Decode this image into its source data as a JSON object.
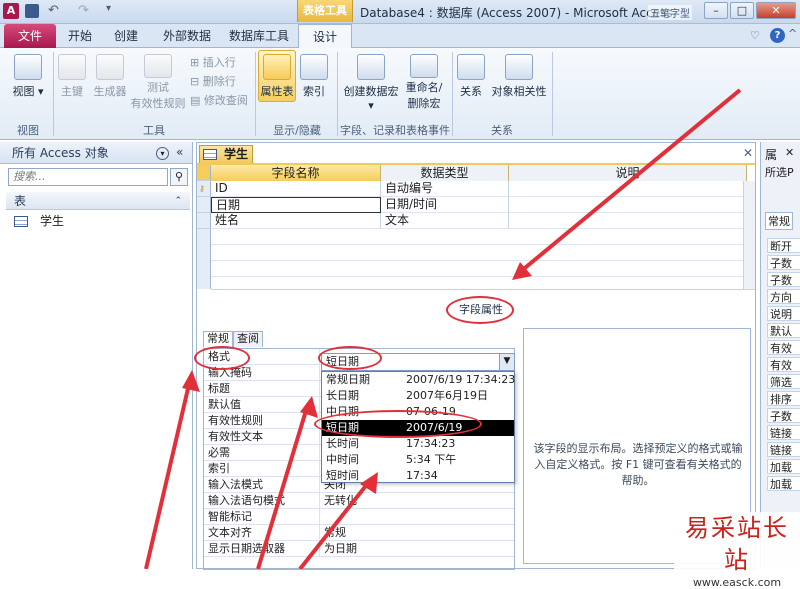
{
  "titlebar": {
    "context_tab": "表格工具",
    "title": "Database4 : 数据库 (Access 2007)  -  Microsoft Access",
    "wm_corner": "五笔字型"
  },
  "tabs": [
    "文件",
    "开始",
    "创建",
    "外部数据",
    "数据库工具",
    "设计"
  ],
  "ribbon": {
    "view": {
      "label": "视图",
      "group": "视图"
    },
    "primary_key": "主键",
    "builder": "生成器",
    "test_rules_l1": "测试",
    "test_rules_l2": "有效性规则",
    "insert_row": "插入行",
    "delete_row": "删除行",
    "modify_lookup": "修改查阅",
    "tools_group": "工具",
    "property_sheet": "属性表",
    "indexes": "索引",
    "showhide_group": "显示/隐藏",
    "create_macro": "创建数据宏",
    "rename_macro_l1": "重命名/",
    "rename_macro_l2": "删除宏",
    "events_group": "字段、记录和表格事件",
    "relationships": "关系",
    "object_dependencies": "对象相关性",
    "rel_group": "关系"
  },
  "nav": {
    "header": "所有 Access 对象",
    "search_placeholder": "搜索...",
    "section": "表",
    "item": "学生"
  },
  "table_tab": "学生",
  "grid": {
    "headers": [
      "字段名称",
      "数据类型",
      "说明"
    ],
    "rows": [
      [
        "ID",
        "自动编号",
        ""
      ],
      [
        "日期",
        "日期/时间",
        ""
      ],
      [
        "姓名",
        "文本",
        ""
      ]
    ]
  },
  "field_props_label": "字段属性",
  "prop_tabs": [
    "常规",
    "查阅"
  ],
  "props": [
    [
      "格式",
      ""
    ],
    [
      "输入掩码",
      ""
    ],
    [
      "标题",
      ""
    ],
    [
      "默认值",
      ""
    ],
    [
      "有效性规则",
      ""
    ],
    [
      "有效性文本",
      ""
    ],
    [
      "必需",
      ""
    ],
    [
      "索引",
      ""
    ],
    [
      "输入法模式",
      "关闭"
    ],
    [
      "输入法语句模式",
      "无转化"
    ],
    [
      "智能标记",
      ""
    ],
    [
      "文本对齐",
      "常规"
    ],
    [
      "显示日期选取器",
      "为日期"
    ]
  ],
  "format_value": "短日期",
  "dropdown": [
    [
      "常规日期",
      "2007/6/19 17:34:23"
    ],
    [
      "长日期",
      "2007年6月19日"
    ],
    [
      "中日期",
      "07-06-19"
    ],
    [
      "短日期",
      "2007/6/19"
    ],
    [
      "长时间",
      "17:34:23"
    ],
    [
      "中时间",
      "5:34 下午"
    ],
    [
      "短时间",
      "17:34"
    ]
  ],
  "help_text": "该字段的显示布局。选择预定义的格式或输入自定义格式。按 F1 键可查看有关格式的帮助。",
  "right_pane": {
    "title": "属",
    "subtitle": "所选P",
    "tab": "常规",
    "items": [
      "断开",
      "子数",
      "子数",
      "方向",
      "说明",
      "默认",
      "有效",
      "有效",
      "筛选",
      "排序",
      "子数",
      "链接",
      "链接",
      "加载",
      "加载"
    ]
  },
  "watermark": {
    "text": "易采站长站",
    "url": "www.easck.com"
  },
  "colors": {
    "file_tab": "#b52158",
    "context": "#f2c95c",
    "annotation": "#e0303a"
  }
}
